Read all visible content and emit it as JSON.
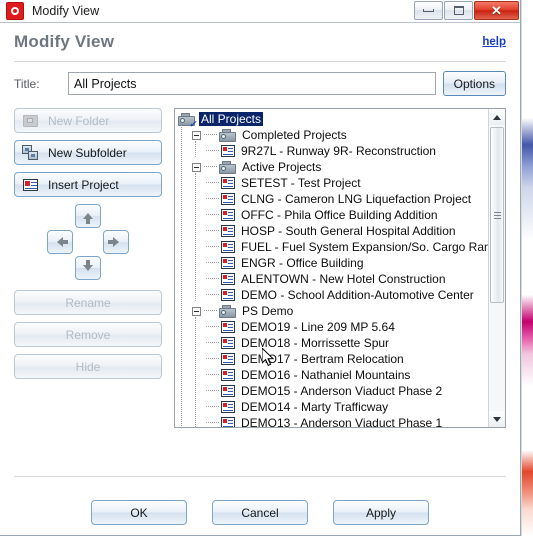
{
  "window": {
    "title": "Modify View",
    "app_icon": "oracle-ring-icon",
    "minimize_label": "Minimize",
    "maximize_label": "Maximize",
    "close_label": "Close",
    "close_glyph": "✕"
  },
  "header": {
    "page_title": "Modify View",
    "help_label": "help"
  },
  "title_field": {
    "label": "Title:",
    "value": "All Projects",
    "placeholder": "",
    "options_label": "Options"
  },
  "side_buttons": [
    {
      "label": "New Folder",
      "icon": "new-folder-icon",
      "enabled": false
    },
    {
      "label": "New Subfolder",
      "icon": "new-subfolder-icon",
      "enabled": true
    },
    {
      "label": "Insert Project",
      "icon": "insert-project-icon",
      "enabled": true
    }
  ],
  "arrow_pad": [
    {
      "name": "move-up-button",
      "direction": "up"
    },
    {
      "name": "move-left-button",
      "direction": "left"
    },
    {
      "name": "move-right-button",
      "direction": "right"
    },
    {
      "name": "move-down-button",
      "direction": "down"
    }
  ],
  "action_buttons": [
    {
      "label": "Rename",
      "enabled": false
    },
    {
      "label": "Remove",
      "enabled": false
    },
    {
      "label": "Hide",
      "enabled": false
    }
  ],
  "tree": {
    "nodes": [
      {
        "label": "All Projects",
        "level": 0,
        "type": "group",
        "expanded": true,
        "selected": true,
        "checked": true
      },
      {
        "label": "Completed Projects",
        "level": 1,
        "type": "group",
        "expanded": true,
        "selected": false,
        "checked": false
      },
      {
        "label": "9R27L - Runway 9R- Reconstruction",
        "level": 2,
        "type": "project",
        "expanded": null,
        "selected": false,
        "checked": false
      },
      {
        "label": "Active Projects",
        "level": 1,
        "type": "group",
        "expanded": true,
        "selected": false,
        "checked": false
      },
      {
        "label": "SETEST - Test Project",
        "level": 2,
        "type": "project",
        "expanded": null,
        "selected": false,
        "checked": false
      },
      {
        "label": "CLNG - Cameron LNG Liquefaction Project",
        "level": 2,
        "type": "project",
        "expanded": null,
        "selected": false,
        "checked": false
      },
      {
        "label": "OFFC - Phila Office Building Addition",
        "level": 2,
        "type": "project",
        "expanded": null,
        "selected": false,
        "checked": false
      },
      {
        "label": "HOSP - South General Hospital Addition",
        "level": 2,
        "type": "project",
        "expanded": null,
        "selected": false,
        "checked": false
      },
      {
        "label": "FUEL - Fuel System Expansion/So. Cargo Ramp",
        "level": 2,
        "type": "project",
        "expanded": null,
        "selected": false,
        "checked": false
      },
      {
        "label": "ENGR - Office Building",
        "level": 2,
        "type": "project",
        "expanded": null,
        "selected": false,
        "checked": false
      },
      {
        "label": "ALENTOWN - New Hotel Construction",
        "level": 2,
        "type": "project",
        "expanded": null,
        "selected": false,
        "checked": false
      },
      {
        "label": "DEMO - School Addition-Automotive Center",
        "level": 2,
        "type": "project",
        "expanded": null,
        "selected": false,
        "checked": false
      },
      {
        "label": "PS Demo",
        "level": 1,
        "type": "group",
        "expanded": true,
        "selected": false,
        "checked": false
      },
      {
        "label": "DEMO19 - Line 209 MP 5.64",
        "level": 2,
        "type": "project",
        "expanded": null,
        "selected": false,
        "checked": false
      },
      {
        "label": "DEMO18 - Morrissette Spur",
        "level": 2,
        "type": "project",
        "expanded": null,
        "selected": false,
        "checked": false
      },
      {
        "label": "DEMO17 - Bertram Relocation",
        "level": 2,
        "type": "project",
        "expanded": null,
        "selected": false,
        "checked": false
      },
      {
        "label": "DEMO16 - Nathaniel Mountains",
        "level": 2,
        "type": "project",
        "expanded": null,
        "selected": false,
        "checked": false
      },
      {
        "label": "DEMO15 - Anderson Viaduct Phase 2",
        "level": 2,
        "type": "project",
        "expanded": null,
        "selected": false,
        "checked": false
      },
      {
        "label": "DEMO14 - Marty Trafficway",
        "level": 2,
        "type": "project",
        "expanded": null,
        "selected": false,
        "checked": false
      },
      {
        "label": "DEMO13 - Anderson Viaduct Phase 1",
        "level": 2,
        "type": "project",
        "expanded": null,
        "selected": false,
        "checked": false
      }
    ],
    "scrollbar": {
      "up_arrow": "▲",
      "down_arrow": "▼"
    }
  },
  "footer": {
    "buttons": [
      {
        "label": "OK"
      },
      {
        "label": "Cancel"
      },
      {
        "label": "Apply"
      }
    ]
  },
  "colors": {
    "selection_blue": "#0a246a",
    "link_blue": "#1a3fb8",
    "close_red": "#e2402c",
    "title_grey": "#6e7780"
  }
}
